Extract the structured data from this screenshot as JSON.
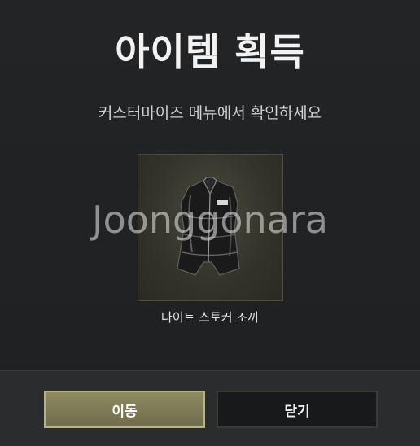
{
  "dialog": {
    "title": "아이템 획득",
    "subtitle": "커스터마이즈 메뉴에서 확인하세요",
    "item": {
      "name": "나이트 스토커 조끼",
      "icon": "vest-icon"
    },
    "watermark": "Joonggonara"
  },
  "buttons": {
    "move_label": "이동",
    "close_label": "닫기"
  },
  "colors": {
    "accent": "#8d8a62",
    "background": "#212325"
  }
}
